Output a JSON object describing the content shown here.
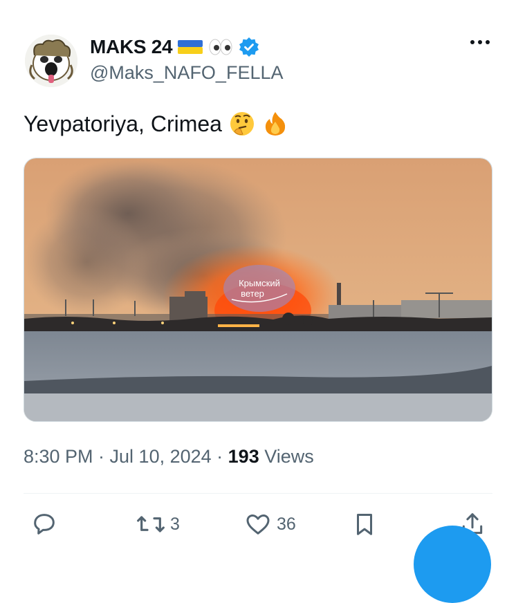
{
  "tweet": {
    "display_name": "MAKS 24",
    "handle": "@Maks_NAFO_FELLA",
    "text": "Yevpatoriya, Crimea",
    "time": "8:30 PM · Jul 10, 2024 · ",
    "views_count": "193",
    "views_label": " Views",
    "media_watermark_line1": "Крымский",
    "media_watermark_line2": "ветер"
  },
  "actions": {
    "reply_count": "",
    "retweet_count": "3",
    "like_count": "36"
  },
  "colors": {
    "accent": "#1d9bf0",
    "secondary_text": "#536471",
    "verified": "#1d9bf0"
  },
  "icons": [
    "ukraine-flag-icon",
    "eyes-icon",
    "verified-icon",
    "more-icon",
    "thinking-face-icon",
    "fire-icon",
    "reply-icon",
    "retweet-icon",
    "like-icon",
    "bookmark-icon",
    "share-icon"
  ]
}
